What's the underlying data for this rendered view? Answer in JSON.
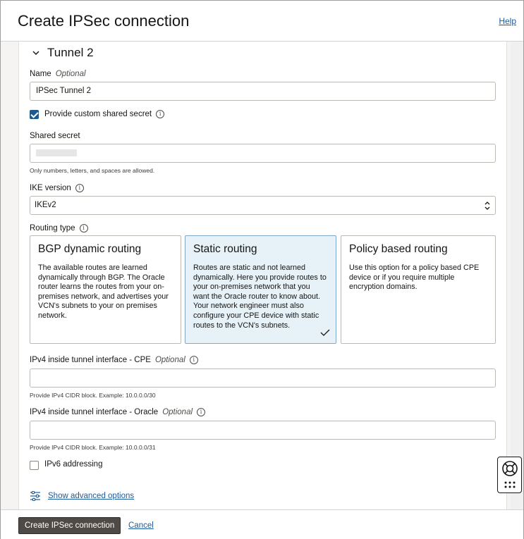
{
  "header": {
    "title": "Create IPSec connection",
    "help_label": "Help"
  },
  "section": {
    "title": "Tunnel 2"
  },
  "name_field": {
    "label": "Name",
    "optional": "Optional",
    "value": "IPSec Tunnel 2"
  },
  "custom_secret": {
    "label": "Provide custom shared secret",
    "checked": true
  },
  "shared_secret": {
    "label": "Shared secret",
    "hint": "Only numbers, letters, and spaces are allowed."
  },
  "ike_version": {
    "label": "IKE version",
    "value": "IKEv2"
  },
  "routing_type": {
    "label": "Routing type",
    "options": [
      {
        "title": "BGP dynamic routing",
        "description": "The available routes are learned dynamically through BGP. The Oracle router learns the routes from your on-premises network, and advertises your VCN's subnets to your on premises network.",
        "selected": false
      },
      {
        "title": "Static routing",
        "description": "Routes are static and not learned dynamically. Here you provide routes to your on-premises network that you want the Oracle router to know about. Your network engineer must also configure your CPE device with static routes to the VCN's subnets.",
        "selected": true
      },
      {
        "title": "Policy based routing",
        "description": "Use this option for a policy based CPE device or if you require multiple encryption domains.",
        "selected": false
      }
    ]
  },
  "ipv4_cpe": {
    "label": "IPv4 inside tunnel interface - CPE",
    "optional": "Optional",
    "value": "",
    "hint": "Provide IPv4 CIDR block. Example: 10.0.0.0/30"
  },
  "ipv4_oracle": {
    "label": "IPv4 inside tunnel interface - Oracle",
    "optional": "Optional",
    "value": "",
    "hint": "Provide IPv4 CIDR block. Example: 10.0.0.0/31"
  },
  "ipv6": {
    "label": "IPv6 addressing",
    "checked": false
  },
  "advanced": {
    "label": "Show advanced options"
  },
  "footer": {
    "primary_label": "Create IPSec connection",
    "cancel_label": "Cancel"
  },
  "icons": {
    "section_toggle": "chevron-down-icon",
    "info": "info-icon",
    "select": "select-arrows-icon",
    "advanced": "sliders-icon",
    "support": "lifebuoy-icon",
    "check": "checkmark-icon"
  },
  "colors": {
    "primary_button": "#4f4a45",
    "link": "#1a5b9c",
    "checkbox_checked": "#1d5b8e",
    "selected_card": "#e6f2f8"
  }
}
